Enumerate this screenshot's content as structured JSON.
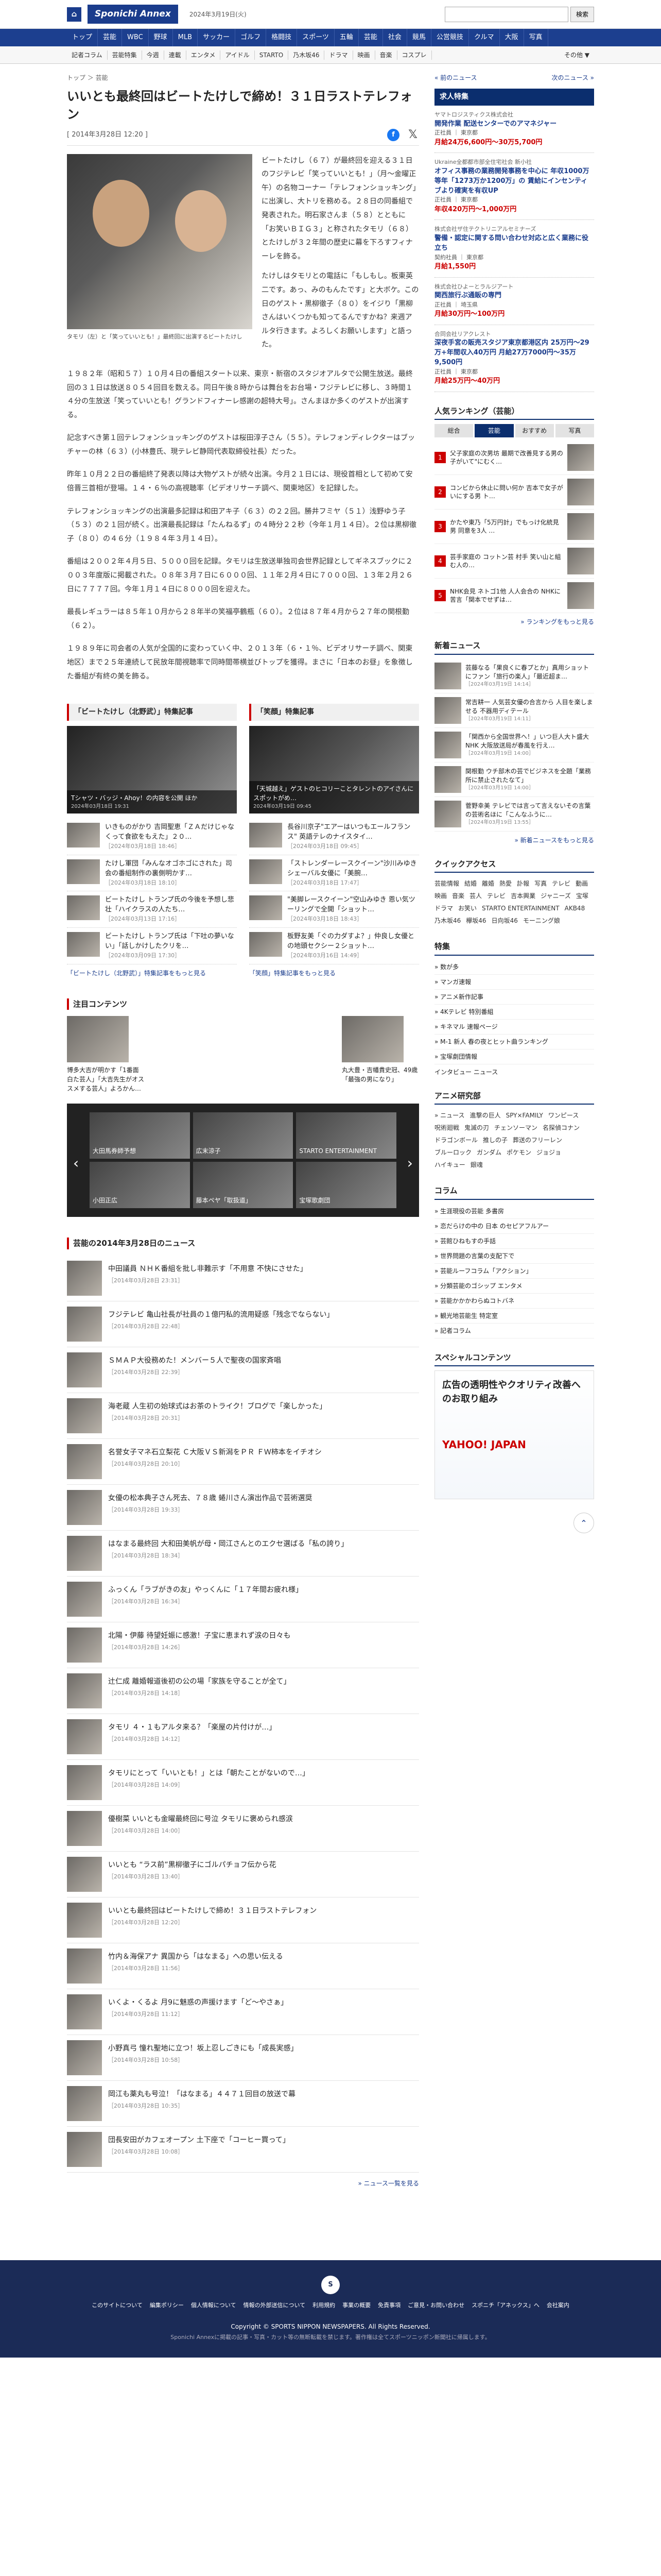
{
  "site": {
    "logo": "Sponichi Annex",
    "date": "2024年3月19日(火)",
    "search_placeholder": "",
    "search_button": "検索"
  },
  "main_nav": [
    "トップ",
    "芸能",
    "WBC",
    "野球",
    "MLB",
    "サッカー",
    "ゴルフ",
    "格闘技",
    "スポーツ",
    "五輪",
    "芸能",
    "社会",
    "競馬",
    "公営競技",
    "クルマ",
    "大阪",
    "写真"
  ],
  "sub_nav": [
    "記者コラム",
    "芸能特集",
    "今週",
    "連載",
    "エンタメ",
    "アイドル",
    "STARTO",
    "乃木坂46",
    "ドラマ",
    "映画",
    "音楽",
    "コスプレ"
  ],
  "sub_nav_more": "その他 ▼",
  "article": {
    "breadcrumb": "トップ ＞ 芸能",
    "title": "いいとも最終回はビートたけしで締め！３１日ラストテレフォン",
    "date": "[ 2014年3月28日 12:20 ]",
    "photo_caption": "タモリ（左）と「笑っていいとも！」最終回に出演するビートたけし",
    "lead_paragraphs": [
      "ビートたけし（６７）が最終回を迎える３１日のフジテレビ「笑っていいとも！」（月〜金曜正午）の名物コーナー「テレフォンショッキング」に出演し、大トリを務める。２８日の同番組で発表された。明石家さんま（５８）とともに「お笑いＢＩＧ３」と称されたタモリ（６８）とたけしが３２年間の歴史に幕を下ろすフィナーレを飾る。",
      "たけしはタモリとの電話に「もしもし。板東英二です。あっ、みのもんたです」と大ボケ。この日のゲスト・黒柳徹子（８０）をイジり「黒柳さんはいくつかも知ってるんですかね？来週アルタ行きます。よろしくお願いします」と語った。"
    ],
    "paragraphs": [
      "１９８２年（昭和５７）１０月４日の番組スタート以来、東京・新宿のスタジオアルタで公開生放送。最終回の３１日は放送８０５４回目を数える。同日午後８時からは舞台をお台場・フジテレビに移し、３時間１４分の生放送「笑っていいとも！グランドフィナーレ感謝の超特大号」。さんまほか多くのゲストが出演する。",
      "記念すべき第１回テレフォンショッキングのゲストは桜田淳子さん（５５）。テレフォンディレクターはブッチャーの林（６３）(小林豊氏、現テレビ静岡代表取締役社長）だった。",
      "昨年１０月２２日の番組終了発表以降は大物ゲストが続々出演。今月２１日には、現役首相として初めて安倍晋三首相が登場。１４・６％の高視聴率（ビデオリサーチ調べ、関東地区）を記録した。",
      "テレフォンショッキングの出演最多記録は和田アキ子（６３）の２２回。勝井フミヤ（５１）浅野ゆう子（５３）の２１回が続く。出演最長記録は「たんねるず」の４時分２２秒（今年１月１４日）。２位は黒柳徹子（８０）の４６分（１９８４年３月１４日）。",
      "番組は２００２年４月５日、５０００回を記録。タモリは生放送単独司会世界記録としてギネスブックに２００３年度版に掲載された。０８年３月７日に６０００回、１１年２月４日に７０００回、１３年２月２６日に７７７７回。今年１月１４日に８０００回を迎えた。",
      "最長レギュラーは８５年１０月から２８年半の笑福亭鶴瓶（６０）。２位は８７年４月から２７年の関根勤（６２）。",
      "１９８９年に司会者の人気が全国的に変わっていく中、２０１３年（６・１％、ビデオリサーチ調べ、関東地区）まで２５年連続して民放年間視聴率で同時間帯横並びトップを獲得。まさに「日本のお昼」を象徴した番組が有終の美を飾る。"
    ]
  },
  "share": {
    "fb": "f",
    "x": "𝕏"
  },
  "related": [
    {
      "heading": "「ビートたけし（北野武）」特集記事",
      "hero": "Tシャツ・バッジ・Ahoy！の内容を公開 ほか",
      "hero_date": "2024年03月18日 19:31",
      "items": [
        {
          "t": "いきものがかり 吉岡聖恵「ＺＡだけじゃなくって食欲をもえた」２０…",
          "d": "［2024年03月18日 18:46］"
        },
        {
          "t": "たけし軍団「みんなオゴホゴにされた」司会の番組制作の裏側明かす…",
          "d": "［2024年03月18日 18:10］"
        },
        {
          "t": "ビートたけし トランプ氏の今後を予想し悲壮「ハイクラスの人たち…",
          "d": "［2024年03月13日 17:16］"
        },
        {
          "t": "ビートたけし トランプ氏は「下吐の夢いない」「話しかけしたクリを…",
          "d": "［2024年03月09日 17:30］"
        }
      ],
      "more": "「ビートたけし（北野武）」特集記事をもっと見る"
    },
    {
      "heading": "「笑顔」特集記事",
      "hero": "「天城越え」ゲストのヒコリーことタレントのアイさんにスポットがめ…",
      "hero_date": "2024年03月19日 09:45",
      "items": [
        {
          "t": "長谷川京子\"エアーはいつもエールフランス\" 英語テレのナイスタイ…",
          "d": "［2024年03月18日 09:45］"
        },
        {
          "t": "「ストレンダーレースクイーン\"沙川みゆき シェーバル女優に「美腕…",
          "d": "［2024年03月18日 17:47］"
        },
        {
          "t": "\"美脚レースクイーン\"空山みゆき 恩い気ツーリングで全開「ショット…",
          "d": "［2024年03月18日 18:43］"
        },
        {
          "t": "板野友美「ぐの力ダすよ？」仲良し女優との地頭セクシー２ショット…",
          "d": "［2024年03月16日 14:49］"
        }
      ],
      "more": "「笑顔」特集記事をもっと見る"
    }
  ],
  "notice": {
    "heading": "注目コンテンツ",
    "items": [
      {
        "t": "博多大吉が明かす「1番面白た芸人」「大吉先生がオススメする芸人」よろかん…"
      },
      {
        "t": "丸大豊・吉幡貴史冠、49歳「最強の男になり」"
      }
    ]
  },
  "carousel": [
    "大田馬券師予想",
    "広末涼子",
    "STARTO ENTERTAINMENT",
    "小田正広",
    "藤本ペヤ「取扱道」",
    "宝塚歌劇団"
  ],
  "news": {
    "heading": "芸能の2014年3月28日のニュース",
    "items": [
      {
        "t": "中田議員 ＮＨＫ番組を批し非難示す「不用意 不快にさせた」",
        "d": "［2014年03月28日 23:31］"
      },
      {
        "t": "フジテレビ 亀山社長が社員の１億円私的流用疑惑「残念でならない」",
        "d": "［2014年03月28日 22:48］"
      },
      {
        "t": "ＳＭＡＰ大役務めた！メンバー５人で聖夜の国家斉唱",
        "d": "［2014年03月28日 22:39］"
      },
      {
        "t": "海老蔵 人生初の始球式はお茶のトライク！ブログで「楽しかった」",
        "d": "［2014年03月28日 20:31］"
      },
      {
        "t": "名誉女子マネ石立梨花 Ｃ大阪ＶＳ新潟をＰＲ ＦＷ柿本をイチオシ",
        "d": "［2014年03月28日 20:10］"
      },
      {
        "t": "女優の松本典子さん死去、７８歳 蜷川さん演出作品で芸術選奨",
        "d": "［2014年03月28日 19:33］"
      },
      {
        "t": "はなまる最終回 大和田美帆が母・岡江さんとのエクセ選ばる「私の誇り」",
        "d": "［2014年03月28日 18:34］"
      },
      {
        "t": "ふっくん「ラブがきの友」やっくんに「１７年間お疲れ様」",
        "d": "［2014年03月28日 16:34］"
      },
      {
        "t": "北陽・伊藤 待望妊娠に感激！子宝に恵まれず涙の日々も",
        "d": "［2014年03月28日 14:26］"
      },
      {
        "t": "辻仁成 離婚報道後初の公の場「家族を守ることが全て」",
        "d": "［2014年03月28日 14:18］"
      },
      {
        "t": "タモリ ４・１もアルタ来る？「楽屋の片付けが…」",
        "d": "［2014年03月28日 14:12］"
      },
      {
        "t": "タモリにとって「いいとも！」とは「朝たことがないので…」",
        "d": "［2014年03月28日 14:09］"
      },
      {
        "t": "優樹菜 いいとも金曜最終回に号泣 タモリに褒められ感涙",
        "d": "［2014年03月28日 14:00］"
      },
      {
        "t": "いいとも “ラス前”黒柳徹子にゴルパチョフ伝から花",
        "d": "［2014年03月28日 13:40］"
      },
      {
        "t": "いいとも最終回はビートたけしで締め！３１日ラストテレフォン",
        "d": "［2014年03月28日 12:20］"
      },
      {
        "t": "竹内＆海保アナ 異国から「はなまる」への思い伝える",
        "d": "［2014年03月28日 11:56］"
      },
      {
        "t": "いくよ・くるよ 月9に魅惑の声援けます「ど〜やさぁ」",
        "d": "［2014年03月28日 11:12］"
      },
      {
        "t": "小野真弓 憧れ聖地に立つ！坂上忍しごきにも「成長実感」",
        "d": "［2014年03月28日 10:58］"
      },
      {
        "t": "岡江も薬丸も号泣！「はなまる」４４７１回目の放送で幕",
        "d": "［2014年03月28日 10:35］"
      },
      {
        "t": "団長安田がカフェオープン 土下座で「コーヒー買って」",
        "d": "［2014年03月28日 10:08］"
      }
    ],
    "more": "» ニュース一覧を見る"
  },
  "sidebar": {
    "breadcrumb_prev": "« 前のニュース",
    "breadcrumb_next": "次のニュース »",
    "jobs_heading": "求人特集",
    "jobs": [
      {
        "co": "ヤマトロジスティクス株式会社",
        "tt": "開発作業 配送センターでのアマネジャー",
        "loc": "正社員 ｜ 東京都",
        "pay": "月給24万6,600円〜30万5,700円"
      },
      {
        "co": "Ukraine全都都市部全住宅社会 新小社",
        "tt": "オフィス事務の業務開発事務を中心に 年収1000万等年「1273万か1200万」の 賃給にインセンティブより確実を有収UP",
        "loc": "正社員 ｜ 東京都",
        "pay": "年収420万円〜1,000万円"
      },
      {
        "co": "株式会社ザ住テクトリニアルセミナーズ",
        "tt": "警備・認定に関する問い合わせ対応と広く業務に役立ち",
        "loc": "契約社員 ｜ 東京都",
        "pay": "月給1,550円"
      },
      {
        "co": "株式会社ひよーとラルジアート",
        "tt": "関西旅行ぶ通販の専門",
        "loc": "正社員 ｜ 埼玉県",
        "pay": "月給30万円〜100万円"
      },
      {
        "co": "合同会社リアクレスト",
        "tt": "深夜手宮の販売スタジア東京都港区内 25万円〜29万+年間収入40万円 月給27万7000円〜35万9,500円",
        "loc": "正社員 ｜ 東京都",
        "pay": "月給25万円〜40万円"
      }
    ],
    "ranking_heading": "人気ランキング（芸能）",
    "ranking_tabs": [
      "総合",
      "芸能",
      "おすすめ",
      "写真"
    ],
    "ranking": [
      "父子家庭の次男坊 最期で改善見する男の子がいて\"にむく…",
      "コンビから休止に問い何か 吉本で女子がいにする男 ト…",
      "かたや東乃「5万円計」でもっけ化統見男 同意を3人 …",
      "芸手家庭の コットン芸 村手 笑い山と組む人の…",
      "NHK会見 ネトゴ1他 人人会合の NHKに苦言「関本でせずは…"
    ],
    "ranking_more": "» ランキングをもっと見る",
    "latest_heading": "新着ニュース",
    "latest": [
      {
        "t": "芸藤なる「果良くに春プとか」真用ショットにファン「旅行の楽人」「最近超ま…",
        "d": "［2024年03月19日 14:14］"
      },
      {
        "t": "常吉耕一 人気芸女優の合言から 人目を楽しませる 不器用ディテール",
        "d": "［2024年03月19日 14:11］"
      },
      {
        "t": "「関西から全国世界へ！」いつ巨人大ト盛大 NHK 大阪放送局が春風を行え…",
        "d": "［2024年03月19日 14:00］"
      },
      {
        "t": "関根勤 ウチ部木の芸でビジネスを全題「業務所に禁止されたなて」",
        "d": "［2024年03月19日 14:00］"
      },
      {
        "t": "菅野幸美 テレビでは言って言えないその言葉の芸術名ほに「こんなふうに…",
        "d": "［2024年03月19日 13:55］"
      }
    ],
    "latest_more": "» 新着ニュースをもっと見る",
    "quick_heading": "クイックアクセス",
    "quick": [
      "芸能情報",
      "結婚",
      "離婚",
      "熱愛",
      "訃報",
      "写真",
      "テレビ",
      "動画",
      "映画",
      "音楽",
      "芸人",
      "テレビ",
      "吉本興業",
      "ジャニーズ",
      "宝塚",
      "ドラマ",
      "お笑い",
      "STARTO ENTERTAINMENT",
      "AKB48",
      "乃木坂46",
      "欅坂46",
      "日向坂46",
      "モーニング娘"
    ],
    "special_heading": "特集",
    "special": [
      "» 数が多",
      "» マンガ速報",
      "» アニメ新作記事",
      "» 4Kテレビ 特別番組",
      "» キネマル 速報ページ",
      "» M-1 新人 春の夜とヒット曲ランキング",
      "» 宝塚劇団情報"
    ],
    "special_tail": "インタビュー ニュース",
    "anime_heading": "アニメ研究部",
    "anime": [
      "» ニュース",
      "進撃の巨人",
      "SPY×FAMILY",
      "ワンピース",
      "呪術廻戦",
      "鬼滅の刃",
      "チェンソーマン",
      "名探偵コナン",
      "ドラゴンボール",
      "推しの子",
      "葬送のフリーレン",
      "ブルーロック",
      "ガンダム",
      "ポケモン",
      "ジョジョ",
      "ハイキュー",
      "銀魂"
    ],
    "column_heading": "コラム",
    "columns": [
      "» 生涯現役の芸能 多書房",
      "» 恋だらけの中の 日本 のセピアフルアー",
      "» 芸館ひねもすの手話",
      "» 世界問題の言葉の支配下で",
      "» 芸能ルーフコラム「アクション」",
      "» 分類芸能のゴシップ エンタメ",
      "» 芸能かかかわらぬコトバネ",
      "» 観光地芸能生 特定室",
      "» 記者コラム"
    ],
    "sp_heading": "スペシャルコンテンツ",
    "ad_text": "広告の透明性やクオリティ改善へのお取り組み",
    "ad_brand": "YAHOO! JAPAN"
  },
  "footer": {
    "links": [
      "このサイトについて",
      "編集ポリシー",
      "個人情報について",
      "情報の外部送信について",
      "利用規約",
      "事業の概要",
      "免責事項",
      "ご意見・お問い合わせ",
      "スポニチ「アネックス」へ",
      "会社案内"
    ],
    "copy": "Copyright © SPORTS NIPPON NEWSPAPERS. All Rights Reserved.",
    "note": "Sponichi Annexに掲載の記事・写真・カット等の無断転載を禁じます。著作権は全てスポーツニッポン新聞社に帰属します。"
  }
}
